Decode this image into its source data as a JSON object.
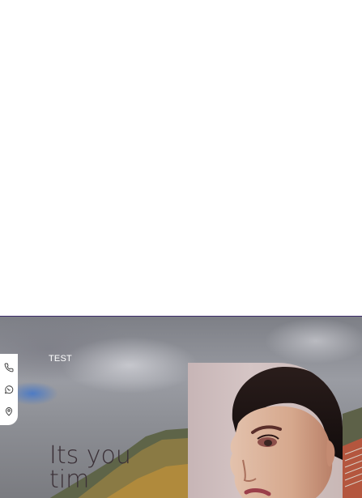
{
  "hero": {
    "brand": "TEST",
    "headline_line1": "Its you",
    "headline_line2": "tim"
  },
  "contact": {
    "items": [
      {
        "icon": "phone-icon"
      },
      {
        "icon": "whatsapp-icon"
      },
      {
        "icon": "location-pin-icon"
      }
    ]
  },
  "colors": {
    "headline": "#3a2f36",
    "brand_text": "#ffffff",
    "hero_border": "#3a2a6a"
  }
}
